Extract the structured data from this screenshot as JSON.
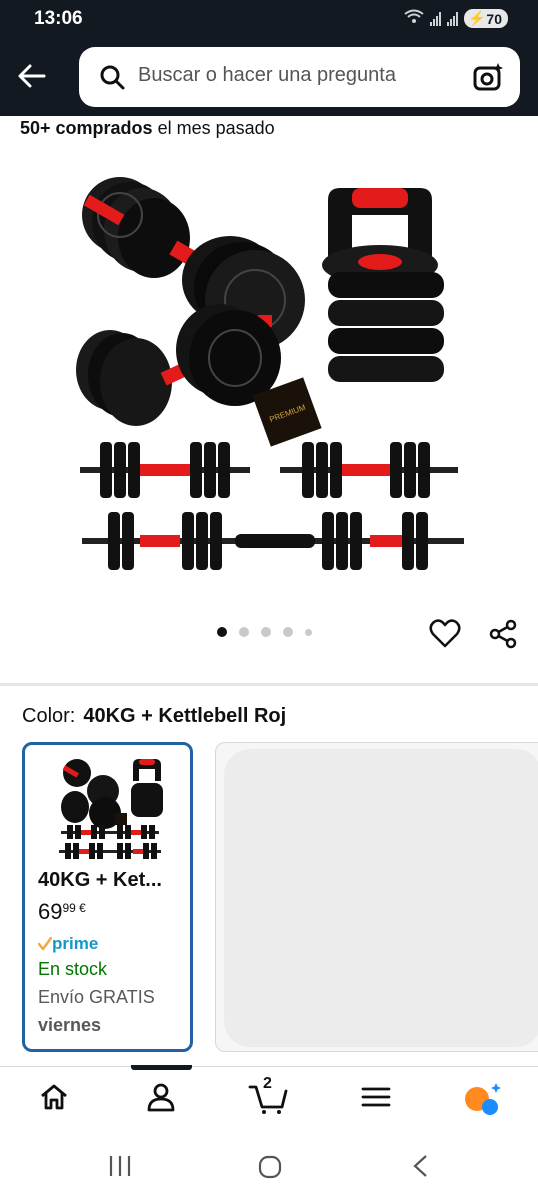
{
  "status": {
    "time": "13:06",
    "battery": "70"
  },
  "search": {
    "placeholder": "Buscar o hacer una pregunta"
  },
  "product": {
    "purchases_bold": "50+ comprados",
    "purchases_rest": " el mes pasado",
    "badge_text": "PREMIUM",
    "carousel": {
      "count": 5,
      "active": 1
    }
  },
  "color": {
    "label": "Color:",
    "value": "40KG + Kettlebell Roj"
  },
  "swatch": {
    "title": "40KG + Ket...",
    "price_whole": "69",
    "price_fraction": "99 €",
    "prime": "prime",
    "stock": "En stock",
    "shipping": "Envío GRATIS",
    "delivery": "viernes"
  },
  "nav": {
    "cart_count": "2"
  },
  "colors": {
    "header": "#131921",
    "selected_border": "#2162a1",
    "in_stock": "#007600",
    "prime": "#1399c9"
  }
}
